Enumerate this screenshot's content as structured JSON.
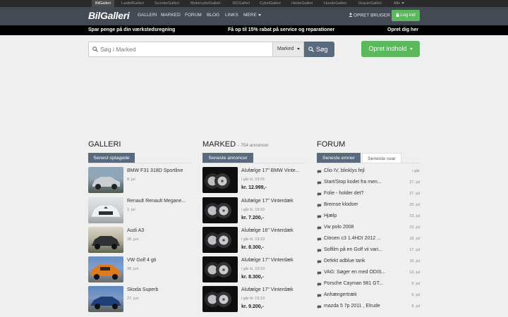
{
  "network": [
    {
      "label": "BilGalleri",
      "active": true
    },
    {
      "label": "LastbilGalleri"
    },
    {
      "label": "ScooterGalleri"
    },
    {
      "label": "MotorcykelGalleri"
    },
    {
      "label": "RCGalleri"
    },
    {
      "label": "CykelGalleri"
    },
    {
      "label": "HesteGalleri"
    },
    {
      "label": "HundeGalleri"
    },
    {
      "label": "GraverGalleri"
    },
    {
      "label": "Alle"
    }
  ],
  "logo": "BilGalleri",
  "nav": [
    "GALLERI",
    "MARKED",
    "FORUM",
    "BLOG",
    "LINKS",
    "MERE"
  ],
  "account": {
    "register": "OPRET BRUGER",
    "login": "Log ind"
  },
  "promo": {
    "left": "Spar penge på din værkstedsregning",
    "center": "Få op til 15% rabat på service og reparationer",
    "right": "Opret dig her"
  },
  "search": {
    "placeholder": "Søg i Marked",
    "scope": "Marked",
    "button": "Søg"
  },
  "create_button": "Opret indhold",
  "galleri": {
    "title": "GALLERI",
    "tab": "Senest optagede",
    "items": [
      {
        "title": "BMW F31 318D Sportline",
        "date": "8. jul"
      },
      {
        "title": "Renault Renault Megane...",
        "date": "2. jul"
      },
      {
        "title": "Audi A3",
        "date": "28. jun"
      },
      {
        "title": "VW Golf 4 gti",
        "date": "28. jun"
      },
      {
        "title": "Skoda Superb",
        "date": "27. jun"
      }
    ]
  },
  "marked": {
    "title": "MARKED",
    "count": "- 754 annoncer",
    "tab": "Seneste annoncer",
    "items": [
      {
        "title": "Alufælge 17\" BMW Vinte...",
        "time": "i går kl. 19:26",
        "price": "kr. 12.999,-"
      },
      {
        "title": "Alufælge 17\" Vinterdæk",
        "time": "i går kl. 19:19",
        "price": "kr. 7.200,-"
      },
      {
        "title": "Alufælge 16\" Vinterdæk",
        "time": "i går kl. 19:19",
        "price": "kr. 8.300,-"
      },
      {
        "title": "Alufælge 17\" Vinterdæk",
        "time": "i går kl. 19:19",
        "price": "kr. 8.300,-"
      },
      {
        "title": "Alufælge 17\" Vinterdæk",
        "time": "i går kl. 19:19",
        "price": "kr. 9.200,-"
      }
    ]
  },
  "forum": {
    "title": "FORUM",
    "tabs": [
      "Seneste emner",
      "Seneste svar"
    ],
    "items": [
      {
        "title": "Clio IV, blinklys fejl",
        "date": "i går"
      },
      {
        "title": "Start/Stop kodet fra men...",
        "date": "27. jul"
      },
      {
        "title": "Folie - holder det?",
        "date": "27. jul"
      },
      {
        "title": "Bremse klodser",
        "date": "25. jul"
      },
      {
        "title": "Hjælp",
        "date": "23. jul"
      },
      {
        "title": "Vw polo 2008",
        "date": "22. jul"
      },
      {
        "title": "Citroen c3 1.4HDI 2012 ...",
        "date": "18. jul"
      },
      {
        "title": "Solfilm på en Golf vii vari...",
        "date": "17. jul"
      },
      {
        "title": "Defekt adblue tank",
        "date": "16. jul"
      },
      {
        "title": "VAG: Søger en med ODIS...",
        "date": "13. jul"
      },
      {
        "title": "Porsche Cayman 981 GT...",
        "date": "9. jul"
      },
      {
        "title": "Anhængertræk",
        "date": "9. jul"
      },
      {
        "title": "mazda 5 7p 2011 , Elrude",
        "date": "8. jul"
      }
    ]
  },
  "colors": {
    "nav": "#434a54",
    "accent": "#5a6a7e",
    "green": "#5cb85c"
  }
}
